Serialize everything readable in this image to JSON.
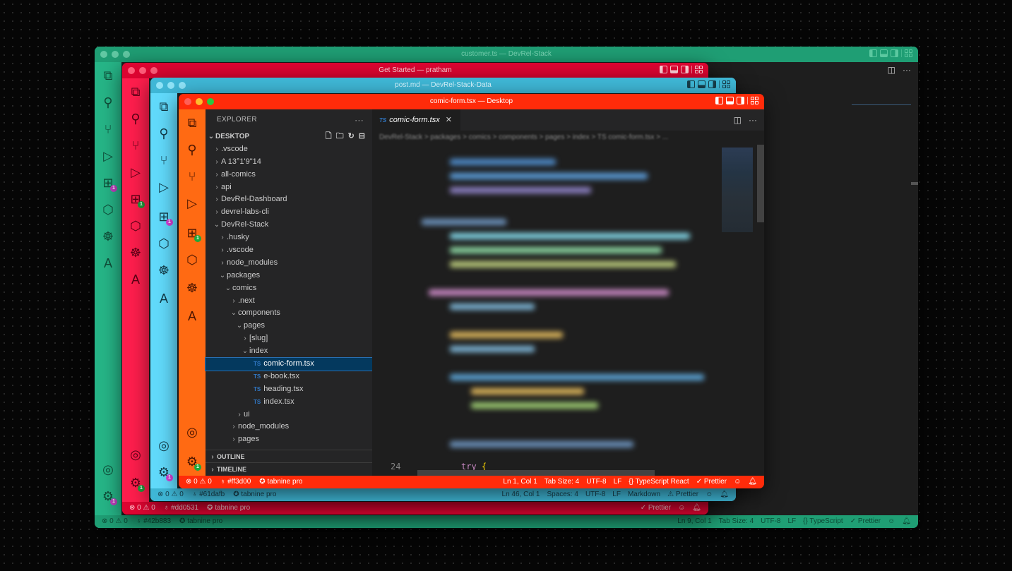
{
  "windows": {
    "green": {
      "title": "customer.ts — DevRel-Stack",
      "color": "#1f9e74",
      "activity_badge": "1",
      "status_left": [
        "⊗ 0 ⚠ 0",
        "♁ #42b883",
        "✪ tabnine pro"
      ],
      "status_right": [
        "Ln 9, Col 1",
        "Tab Size: 4",
        "UTF-8",
        "LF",
        "{} TypeScript",
        "✓ Prettier"
      ]
    },
    "red": {
      "title": "Get Started — pratham",
      "color": "#dd0531",
      "activity_badge": "1",
      "status_left": [
        "⊗ 0 ⚠ 0",
        "♁ #dd0531",
        "✪ tabnine pro"
      ],
      "status_right": [
        "✓ Prettier"
      ]
    },
    "cyan": {
      "title": "post.md — DevRel-Stack-Data",
      "color": "#61dafb",
      "activity_badge": "1",
      "status_left": [
        "⊗ 0 ⚠ 0",
        "♁ #61dafb",
        "✪ tabnine pro"
      ],
      "status_right": [
        "Ln 46, Col 1",
        "Spaces: 4",
        "UTF-8",
        "LF",
        "Markdown",
        "⚠ Prettier"
      ]
    },
    "front": {
      "title": "comic-form.tsx — Desktop",
      "color": "#ff3d00",
      "activity_badge": "1",
      "status_left": [
        "⊗ 0 ⚠ 0",
        "♁ #ff3d00",
        "✪ tabnine pro"
      ],
      "status_right": [
        "Ln 1, Col 1",
        "Tab Size: 4",
        "UTF-8",
        "LF",
        "{} TypeScript React",
        "✓ Prettier"
      ]
    }
  },
  "explorer": {
    "header": "EXPLORER",
    "more": "···",
    "root": "DESKTOP",
    "tree": [
      {
        "label": ".vscode",
        "depth": 1,
        "type": "folder",
        "open": false
      },
      {
        "label": "A 13°1'9\"14",
        "depth": 1,
        "type": "folder",
        "open": false
      },
      {
        "label": "all-comics",
        "depth": 1,
        "type": "folder",
        "open": false
      },
      {
        "label": "api",
        "depth": 1,
        "type": "folder",
        "open": false
      },
      {
        "label": "DevRel-Dashboard",
        "depth": 1,
        "type": "folder",
        "open": false
      },
      {
        "label": "devrel-labs-cli",
        "depth": 1,
        "type": "folder",
        "open": false
      },
      {
        "label": "DevRel-Stack",
        "depth": 1,
        "type": "folder",
        "open": true
      },
      {
        "label": ".husky",
        "depth": 2,
        "type": "folder",
        "open": false
      },
      {
        "label": ".vscode",
        "depth": 2,
        "type": "folder",
        "open": false
      },
      {
        "label": "node_modules",
        "depth": 2,
        "type": "folder",
        "open": false
      },
      {
        "label": "packages",
        "depth": 2,
        "type": "folder",
        "open": true
      },
      {
        "label": "comics",
        "depth": 3,
        "type": "folder",
        "open": true
      },
      {
        "label": ".next",
        "depth": 4,
        "type": "folder",
        "open": false
      },
      {
        "label": "components",
        "depth": 4,
        "type": "folder",
        "open": true
      },
      {
        "label": "pages",
        "depth": 5,
        "type": "folder",
        "open": true
      },
      {
        "label": "[slug]",
        "depth": 6,
        "type": "folder",
        "open": false
      },
      {
        "label": "index",
        "depth": 6,
        "type": "folder",
        "open": true
      },
      {
        "label": "comic-form.tsx",
        "depth": 7,
        "type": "ts",
        "selected": true
      },
      {
        "label": "e-book.tsx",
        "depth": 7,
        "type": "ts"
      },
      {
        "label": "heading.tsx",
        "depth": 7,
        "type": "ts"
      },
      {
        "label": "index.tsx",
        "depth": 7,
        "type": "ts"
      },
      {
        "label": "ui",
        "depth": 5,
        "type": "folder",
        "open": false
      },
      {
        "label": "node_modules",
        "depth": 4,
        "type": "folder",
        "open": false
      },
      {
        "label": "pages",
        "depth": 4,
        "type": "folder",
        "open": false
      }
    ],
    "outline": "OUTLINE",
    "timeline": "TIMELINE"
  },
  "editor": {
    "tab_label": "comic-form.tsx",
    "tab_badge": "TS",
    "breadcrumb": "DevRel-Stack > packages > comics > components > pages > index > TS comic-form.tsx > ...",
    "line_number": "24",
    "code_keyword": "try",
    "code_brace": "{"
  },
  "icons": [
    "files-icon",
    "search-icon",
    "source-control-icon",
    "run-debug-icon",
    "extensions-icon",
    "remote-icon",
    "octopus-icon",
    "azure-icon",
    "account-icon",
    "settings-gear-icon"
  ]
}
